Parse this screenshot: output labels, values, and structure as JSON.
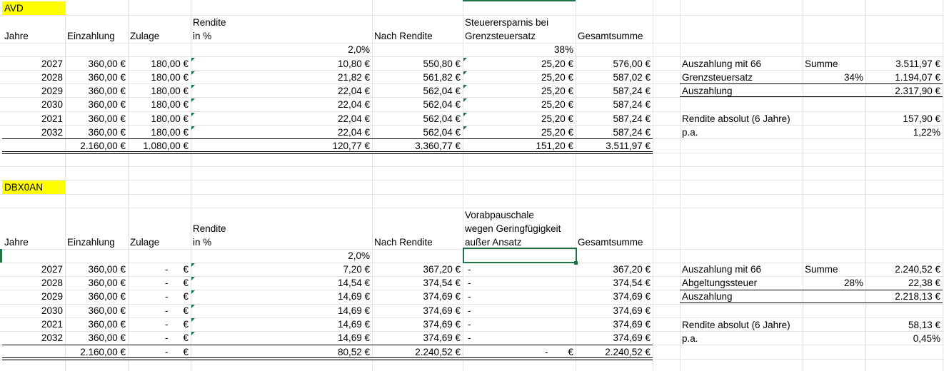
{
  "avd": {
    "label": "AVD",
    "headers": {
      "jahre": "Jahre",
      "einzahlung": "Einzahlung",
      "zulage": "Zulage",
      "rendite_l1": "Rendite",
      "rendite_l2": "in %",
      "nach_rendite": "Nach Rendite",
      "steuer_l1": "Steuerersparnis bei",
      "steuer_l2": "Grenzsteuersatz",
      "gesamtsumme": "Gesamtsumme"
    },
    "rendite_pct": "2,0%",
    "steuersatz_pct": "38%",
    "rows": [
      {
        "jahr": "2027",
        "einzahlung": "360,00 €",
        "zulage": "180,00 €",
        "rendite": "10,80 €",
        "nach_rendite": "550,80 €",
        "steuer": "25,20 €",
        "gesamt": "576,00 €"
      },
      {
        "jahr": "2028",
        "einzahlung": "360,00 €",
        "zulage": "180,00 €",
        "rendite": "21,82 €",
        "nach_rendite": "561,82 €",
        "steuer": "25,20 €",
        "gesamt": "587,02 €"
      },
      {
        "jahr": "2029",
        "einzahlung": "360,00 €",
        "zulage": "180,00 €",
        "rendite": "22,04 €",
        "nach_rendite": "562,04 €",
        "steuer": "25,20 €",
        "gesamt": "587,24 €"
      },
      {
        "jahr": "2030",
        "einzahlung": "360,00 €",
        "zulage": "180,00 €",
        "rendite": "22,04 €",
        "nach_rendite": "562,04 €",
        "steuer": "25,20 €",
        "gesamt": "587,24 €"
      },
      {
        "jahr": "2021",
        "einzahlung": "360,00 €",
        "zulage": "180,00 €",
        "rendite": "22,04 €",
        "nach_rendite": "562,04 €",
        "steuer": "25,20 €",
        "gesamt": "587,24 €"
      },
      {
        "jahr": "2032",
        "einzahlung": "360,00 €",
        "zulage": "180,00 €",
        "rendite": "22,04 €",
        "nach_rendite": "562,04 €",
        "steuer": "25,20 €",
        "gesamt": "587,24 €"
      }
    ],
    "totals": {
      "einzahlung": "2.160,00 €",
      "zulage": "1.080,00 €",
      "rendite": "120,77 €",
      "nach_rendite": "3.360,77 €",
      "steuer": "151,20 €",
      "gesamt": "3.511,97 €"
    },
    "summary": {
      "auszahlung66_label": "Auszahlung mit 66",
      "summe_label": "Summe",
      "summe_value": "3.511,97 €",
      "grenz_label": "Grenzsteuersatz",
      "grenz_pct": "34%",
      "grenz_value": "1.194,07 €",
      "auszahlung_label": "Auszahlung",
      "auszahlung_value": "2.317,90 €",
      "rendite_abs_label": "Rendite absolut (6 Jahre)",
      "rendite_abs_value": "157,90 €",
      "pa_label": "p.a.",
      "pa_value": "1,22%"
    }
  },
  "dbx": {
    "label": "DBX0AN",
    "headers": {
      "jahre": "Jahre",
      "einzahlung": "Einzahlung",
      "zulage": "Zulage",
      "rendite_l1": "Rendite",
      "rendite_l2": "in %",
      "nach_rendite": "Nach Rendite",
      "vorab_l1": "Vorabpauschale",
      "vorab_l2": "wegen Geringfügigkeit",
      "vorab_l3": "außer Ansatz",
      "gesamtsumme": "Gesamtsumme"
    },
    "rendite_pct": "2,0%",
    "rows": [
      {
        "jahr": "2027",
        "einzahlung": "360,00 €",
        "zulage": "-",
        "zulage_eur": "€",
        "rendite": "7,20 €",
        "nach_rendite": "367,20 €",
        "vorab": "-",
        "gesamt": "367,20 €"
      },
      {
        "jahr": "2028",
        "einzahlung": "360,00 €",
        "zulage": "-",
        "zulage_eur": "€",
        "rendite": "14,54 €",
        "nach_rendite": "374,54 €",
        "vorab": "-",
        "gesamt": "374,54 €"
      },
      {
        "jahr": "2029",
        "einzahlung": "360,00 €",
        "zulage": "-",
        "zulage_eur": "€",
        "rendite": "14,69 €",
        "nach_rendite": "374,69 €",
        "vorab": "-",
        "gesamt": "374,69 €"
      },
      {
        "jahr": "2030",
        "einzahlung": "360,00 €",
        "zulage": "-",
        "zulage_eur": "€",
        "rendite": "14,69 €",
        "nach_rendite": "374,69 €",
        "vorab": "-",
        "gesamt": "374,69 €"
      },
      {
        "jahr": "2021",
        "einzahlung": "360,00 €",
        "zulage": "-",
        "zulage_eur": "€",
        "rendite": "14,69 €",
        "nach_rendite": "374,69 €",
        "vorab": "-",
        "gesamt": "374,69 €"
      },
      {
        "jahr": "2032",
        "einzahlung": "360,00 €",
        "zulage": "-",
        "zulage_eur": "€",
        "rendite": "14,69 €",
        "nach_rendite": "374,69 €",
        "vorab": "-",
        "gesamt": "374,69 €"
      }
    ],
    "totals": {
      "einzahlung": "2.160,00 €",
      "zulage": "-",
      "zulage_eur": "€",
      "rendite": "80,52 €",
      "nach_rendite": "2.240,52 €",
      "vorab": "-",
      "vorab_eur": "€",
      "gesamt": "2.240,52 €"
    },
    "summary": {
      "auszahlung66_label": "Auszahlung mit 66",
      "summe_label": "Summe",
      "summe_value": "2.240,52 €",
      "abgeltung_label": "Abgeltungssteuer",
      "abgeltung_pct": "28%",
      "abgeltung_value": "22,38 €",
      "auszahlung_label": "Auszahlung",
      "auszahlung_value": "2.218,13 €",
      "rendite_abs_label": "Rendite absolut (6 Jahre)",
      "rendite_abs_value": "58,13 €",
      "pa_label": "p.a.",
      "pa_value": "0,45%"
    }
  },
  "colors": {
    "highlight": "#ffff00",
    "selection": "#217346",
    "grid": "#e3e3e3",
    "error_triangle": "#107c41"
  }
}
